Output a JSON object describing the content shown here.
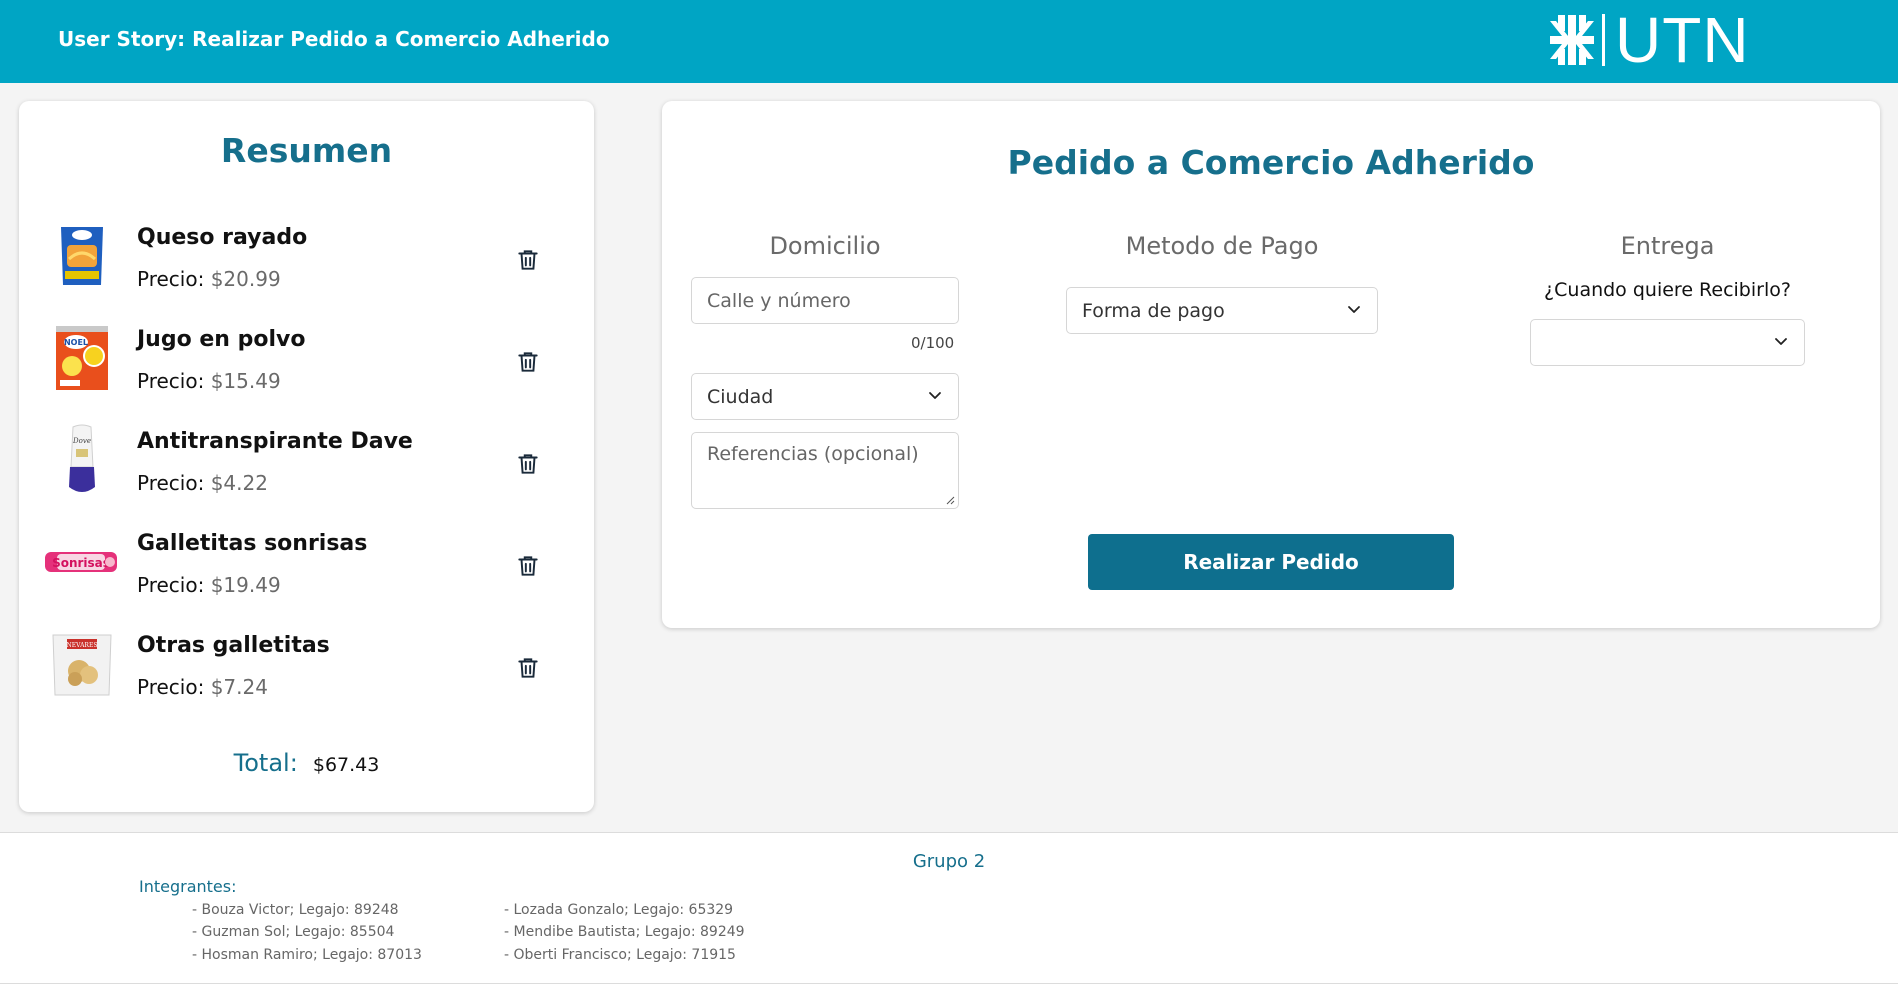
{
  "header": {
    "title": "User Story: Realizar Pedido a Comercio Adherido",
    "logo_text": "UTN",
    "background": "#00a5c4"
  },
  "summary": {
    "title": "Resumen",
    "price_label": "Precio:",
    "items": [
      {
        "name": "Queso rayado",
        "price": "$20.99",
        "icon": "cheese-bag-image"
      },
      {
        "name": "Jugo en polvo",
        "price": "$15.49",
        "icon": "juice-packet-image"
      },
      {
        "name": "Antitranspirante Dave",
        "price": "$4.22",
        "icon": "deodorant-image"
      },
      {
        "name": "Galletitas sonrisas",
        "price": "$19.49",
        "icon": "sonrisas-cookies-image"
      },
      {
        "name": "Otras galletitas",
        "price": "$7.24",
        "icon": "cookie-bag-image"
      }
    ],
    "total_label": "Total:",
    "total_value": "$67.43"
  },
  "order": {
    "title": "Pedido a Comercio Adherido",
    "domicilio": {
      "title": "Domicilio",
      "street_placeholder": "Calle y número",
      "street_counter": "0/100",
      "city_value": "Ciudad",
      "references_placeholder": "Referencias (opcional)"
    },
    "pago": {
      "title": "Metodo de Pago",
      "select_value": "Forma de pago"
    },
    "entrega": {
      "title": "Entrega",
      "question": "¿Cuando quiere Recibirlo?",
      "select_value": ""
    },
    "submit_label": "Realizar Pedido",
    "accent": "#0e6f8e"
  },
  "footer": {
    "group": "Grupo 2",
    "integrantes_label": "Integrantes:",
    "members_left": [
      "- Bouza Victor; Legajo: 89248",
      "- Guzman Sol; Legajo: 85504",
      "- Hosman Ramiro; Legajo: 87013"
    ],
    "members_right": [
      "- Lozada Gonzalo; Legajo: 65329",
      "- Mendibe Bautista; Legajo: 89249",
      "- Oberti Francisco; Legajo: 71915"
    ]
  }
}
